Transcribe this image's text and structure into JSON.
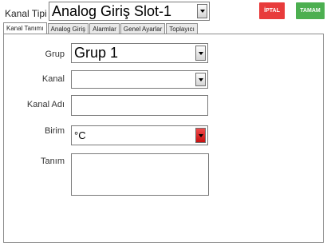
{
  "header": {
    "channel_type_label": "Kanal Tipi",
    "channel_type_value": "Analog Giriş Slot-1",
    "cancel_label": "İPTAL",
    "ok_label": "TAMAM"
  },
  "tabs": [
    {
      "label": "Kanal Tanımı",
      "active": true
    },
    {
      "label": "Analog Giriş",
      "active": false
    },
    {
      "label": "Alarmlar",
      "active": false
    },
    {
      "label": "Genel Ayarlar",
      "active": false
    },
    {
      "label": "Toplayıcı",
      "active": false
    }
  ],
  "form": {
    "group_label": "Grup",
    "group_value": "Grup 1",
    "channel_label": "Kanal",
    "channel_value": "",
    "channel_name_label": "Kanal Adı",
    "channel_name_value": "",
    "unit_label": "Birim",
    "unit_value": "°C",
    "description_label": "Tanım",
    "description_value": ""
  },
  "colors": {
    "cancel": "#e83b3b",
    "ok": "#4caf50",
    "dropdown_accent": "#d01818"
  }
}
